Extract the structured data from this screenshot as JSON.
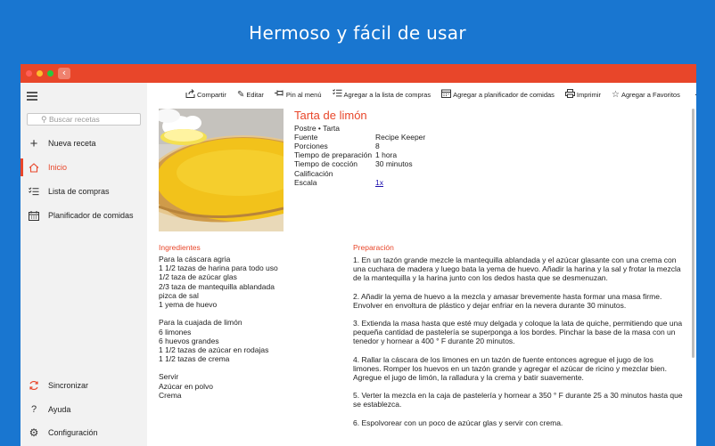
{
  "banner": {
    "text": "Hermoso y fácil de usar"
  },
  "colors": {
    "accent": "#e8462a",
    "banner_bg": "#1976d0",
    "sidebar_bg": "#f2f2f2",
    "link": "#1a0dab"
  },
  "window": {
    "traffic_lights": [
      "#ff5f57",
      "#febc2e",
      "#28c840"
    ],
    "back_icon": "chevron-left-icon"
  },
  "sidebar": {
    "search_placeholder": "Buscar recetas",
    "items": [
      {
        "label": "Nueva receta",
        "icon": "plus-icon"
      },
      {
        "label": "Inicio",
        "icon": "home-icon",
        "active": true
      },
      {
        "label": "Lista de compras",
        "icon": "checklist-icon"
      },
      {
        "label": "Planificador de comidas",
        "icon": "calendar-icon"
      }
    ],
    "bottom_items": [
      {
        "label": "Sincronizar",
        "icon": "sync-icon"
      },
      {
        "label": "Ayuda",
        "icon": "question-icon"
      },
      {
        "label": "Configuración",
        "icon": "gear-icon"
      }
    ]
  },
  "toolbar": {
    "share": "Compartir",
    "edit": "Editar",
    "pin": "Pin al menú",
    "add_list": "Agregar a la lista de compras",
    "add_planner": "Agregar a planificador de comidas",
    "print": "Imprimir",
    "favorites": "Agregar a Favoritos",
    "more": "···"
  },
  "recipe": {
    "title": "Tarta de limón",
    "category": "Postre • Tarta",
    "fields": {
      "source_label": "Fuente",
      "source_value": "Recipe Keeper",
      "servings_label": "Porciones",
      "servings_value": "8",
      "prep_label": "Tiempo de preparación",
      "prep_value": "1 hora",
      "cook_label": "Tiempo de cocción",
      "cook_value": "30 minutos",
      "rating_label": "Calificación",
      "scale_label": "Escala",
      "scale_value": "1x"
    },
    "ingredients_heading": "Ingredientes",
    "ingredients": [
      "Para la cáscara agria",
      "1 1/2 tazas de harina para todo uso",
      "1/2 taza de azúcar glas",
      "2/3 taza de mantequilla ablandada",
      "pizca de sal",
      "1 yema de huevo",
      "",
      "Para la cuajada de limón",
      "6 limones",
      "6 huevos grandes",
      "1 1/2 tazas de azúcar en rodajas",
      "1 1/2 tazas de crema",
      "",
      "Servir",
      "Azúcar en polvo",
      "Crema"
    ],
    "instructions_heading": "Preparación",
    "instructions": [
      "1. En un tazón grande mezcle la mantequilla ablandada y el azúcar glasante con una crema con una cuchara de madera y luego bata la yema de huevo. Añadir la harina y la sal y frotar la mezcla de la mantequilla y la harina junto con los dedos hasta que se desmenuzan.",
      "2. Añadir la yema de huevo a la mezcla y amasar brevemente hasta formar una masa firme. Envolver en envoltura de plástico y dejar enfriar en la nevera durante 30 minutos.",
      "3. Extienda la masa hasta que esté muy delgada y coloque la lata de quiche, permitiendo que una pequeña cantidad de pastelería se superponga a los bordes. Pinchar la base de la masa con un tenedor y hornear a 400 ° F durante 20 minutos.",
      "4. Rallar la cáscara de los limones en un tazón de fuente entonces agregue el jugo de los limones. Romper los huevos en un tazón grande y agregar el azúcar de ricino y mezclar bien. Agregue el jugo de limón, la ralladura y la crema y batir suavemente.",
      "5. Verter la mezcla en la caja de pastelería y hornear a 350 ° F durante 25 a 30 minutos hasta que se establezca.",
      "6. Espolvorear con un poco de azúcar glas y servir con crema."
    ]
  }
}
